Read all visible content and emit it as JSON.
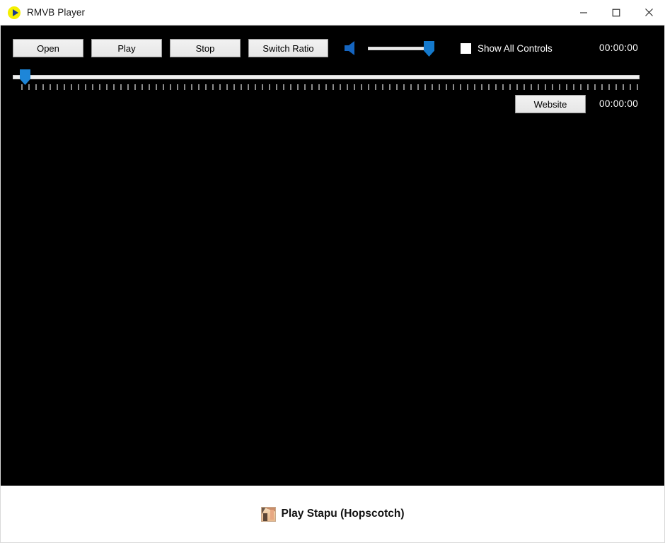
{
  "window": {
    "title": "RMVB Player",
    "app_icon": "play-circle-icon",
    "controls": {
      "minimize": "minimize-icon",
      "maximize": "maximize-icon",
      "close": "close-icon"
    }
  },
  "toolbar": {
    "open_label": "Open",
    "play_label": "Play",
    "stop_label": "Stop",
    "switch_ratio_label": "Switch Ratio",
    "speaker_icon": "speaker-icon",
    "volume": {
      "value": 92,
      "min": 0,
      "max": 100
    },
    "show_all_controls": {
      "label": "Show All Controls",
      "checked": false
    },
    "elapsed_time": "00:00:00"
  },
  "seekbar": {
    "value": 0,
    "min": 0,
    "max": 100
  },
  "secondary_row": {
    "website_label": "Website",
    "total_time": "00:00:00"
  },
  "bottom_bar": {
    "promo_icon": "video-thumbnail-icon",
    "promo_label": "Play Stapu (Hopscotch)"
  },
  "colors": {
    "accent_blue": "#1479cc",
    "seek_blue": "#1e86d8",
    "icon_yellow": "#f5f000",
    "icon_triangle": "#1a3a8f",
    "video_background": "#000000",
    "button_face": "#e6e6e6"
  }
}
